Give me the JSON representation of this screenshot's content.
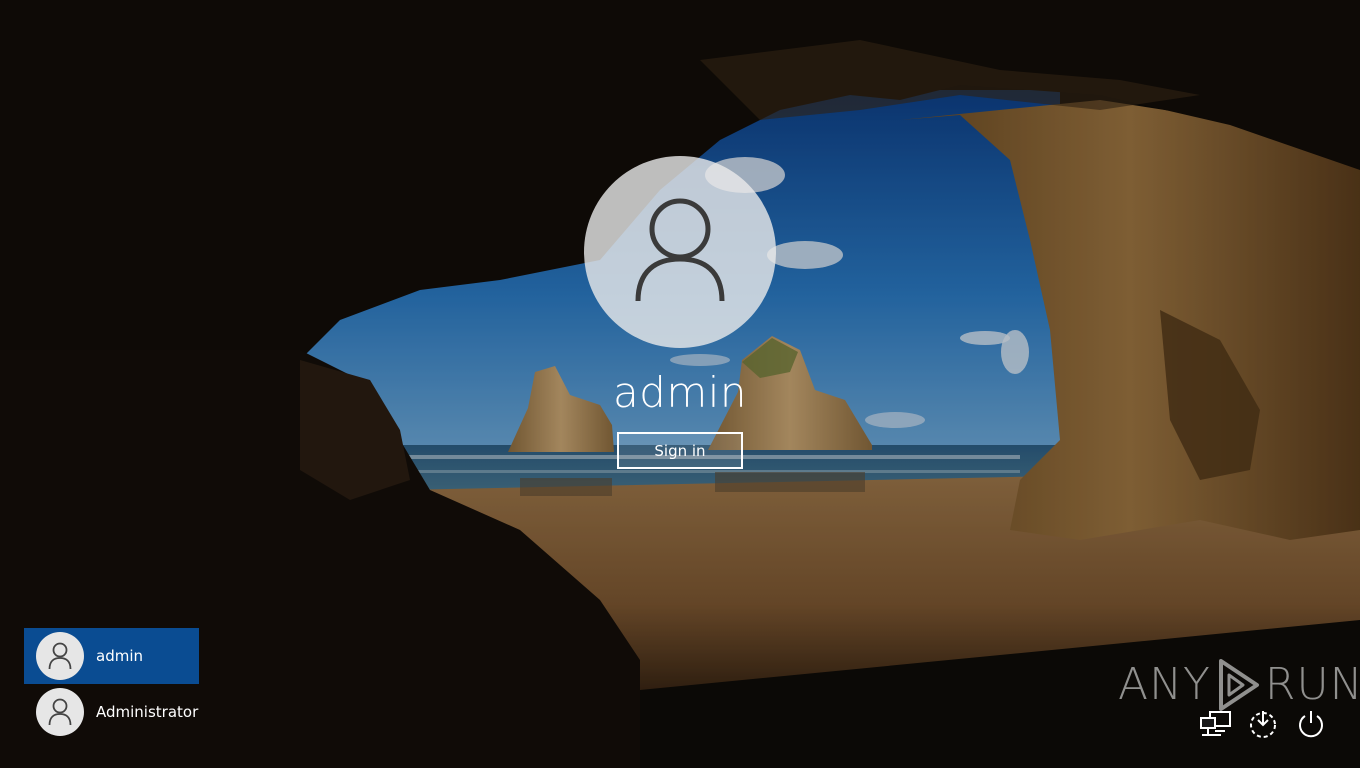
{
  "lock_screen": {
    "selected_user": "admin",
    "sign_in_label": "Sign in"
  },
  "users": [
    {
      "name": "admin",
      "selected": true
    },
    {
      "name": "Administrator",
      "selected": false
    }
  ],
  "watermark": {
    "left_text": "ANY",
    "right_text": "RUN"
  },
  "icons": {
    "avatar": "user-silhouette-icon",
    "network": "network-icon",
    "ease_of_access": "ease-of-access-icon",
    "power": "power-icon"
  },
  "colors": {
    "selected_user_bg": "#0a4c92",
    "text": "#ffffff"
  }
}
